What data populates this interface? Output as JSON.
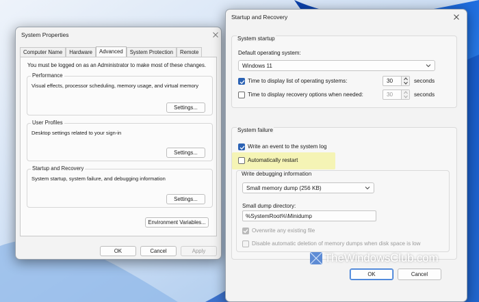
{
  "system_properties": {
    "title": "System Properties",
    "tabs": [
      {
        "label": "Computer Name",
        "active": false
      },
      {
        "label": "Hardware",
        "active": false
      },
      {
        "label": "Advanced",
        "active": true
      },
      {
        "label": "System Protection",
        "active": false
      },
      {
        "label": "Remote",
        "active": false
      }
    ],
    "notice": "You must be logged on as an Administrator to make most of these changes.",
    "groups": {
      "performance": {
        "title": "Performance",
        "description": "Visual effects, processor scheduling, memory usage, and virtual memory",
        "button": "Settings..."
      },
      "user_profiles": {
        "title": "User Profiles",
        "description": "Desktop settings related to your sign-in",
        "button": "Settings..."
      },
      "startup_recovery": {
        "title": "Startup and Recovery",
        "description": "System startup, system failure, and debugging information",
        "button": "Settings..."
      }
    },
    "env_button": "Environment Variables...",
    "ok": "OK",
    "cancel": "Cancel",
    "apply": "Apply"
  },
  "startup_recovery": {
    "title": "Startup and Recovery",
    "system_startup": {
      "heading": "System startup",
      "default_os_label": "Default operating system:",
      "default_os_value": "Windows 11",
      "time_list": {
        "label": "Time to display list of operating systems:",
        "checked": true,
        "value": "30",
        "unit": "seconds"
      },
      "time_recovery": {
        "label": "Time to display recovery options when needed:",
        "checked": false,
        "value": "30",
        "unit": "seconds"
      }
    },
    "system_failure": {
      "heading": "System failure",
      "write_event": {
        "label": "Write an event to the system log",
        "checked": true
      },
      "auto_restart": {
        "label": "Automatically restart",
        "checked": false
      },
      "debug_heading": "Write debugging information",
      "dump_type": "Small memory dump (256 KB)",
      "dump_dir_label": "Small dump directory:",
      "dump_dir_value": "%SystemRoot%\\Minidump",
      "overwrite": {
        "label": "Overwrite any existing file",
        "checked": true,
        "enabled": false
      },
      "disable_auto_delete": {
        "label": "Disable automatic deletion of memory dumps when disk space is low",
        "checked": false,
        "enabled": false
      }
    },
    "ok": "OK",
    "cancel": "Cancel"
  },
  "watermark": "TheWindowsClub.com",
  "colors": {
    "accent": "#2b62b4",
    "highlight": "#f5f3a9",
    "wallpaper": "#1f63c9"
  }
}
